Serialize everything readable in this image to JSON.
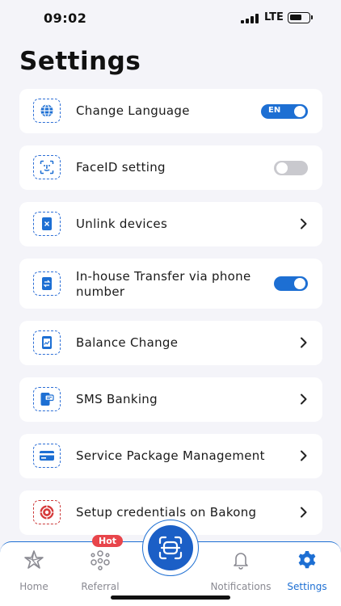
{
  "status": {
    "time": "09:02",
    "network": "LTE"
  },
  "page": {
    "title": "Settings"
  },
  "settings": [
    {
      "label": "Change Language",
      "control": "toggle",
      "on": true,
      "toggle_text": "EN",
      "icon": "globe-icon"
    },
    {
      "label": "FaceID setting",
      "control": "toggle",
      "on": false,
      "icon": "face-id-icon"
    },
    {
      "label": "Unlink devices",
      "control": "chevron",
      "icon": "unlink-device-icon"
    },
    {
      "label": "In-house Transfer via phone number",
      "control": "toggle",
      "on": true,
      "icon": "phone-transfer-icon"
    },
    {
      "label": "Balance Change",
      "control": "chevron",
      "icon": "balance-chart-icon"
    },
    {
      "label": "SMS Banking",
      "control": "chevron",
      "icon": "sms-phone-icon"
    },
    {
      "label": "Service Package Management",
      "control": "chevron",
      "icon": "card-icon"
    },
    {
      "label": "Setup credentials on Bakong",
      "control": "chevron",
      "icon": "bakong-icon"
    }
  ],
  "nav": {
    "items": [
      {
        "label": "Home",
        "icon": "home-star-icon",
        "active": false
      },
      {
        "label": "Referral",
        "icon": "referral-icon",
        "active": false,
        "badge": "Hot"
      },
      {
        "label": "Notifications",
        "icon": "bell-icon",
        "active": false
      },
      {
        "label": "Settings",
        "icon": "gear-icon",
        "active": true
      }
    ],
    "center_icon": "scan-icon"
  },
  "colors": {
    "accent": "#1d6fd3",
    "badge": "#e8454b",
    "background": "#f4f4f9"
  }
}
